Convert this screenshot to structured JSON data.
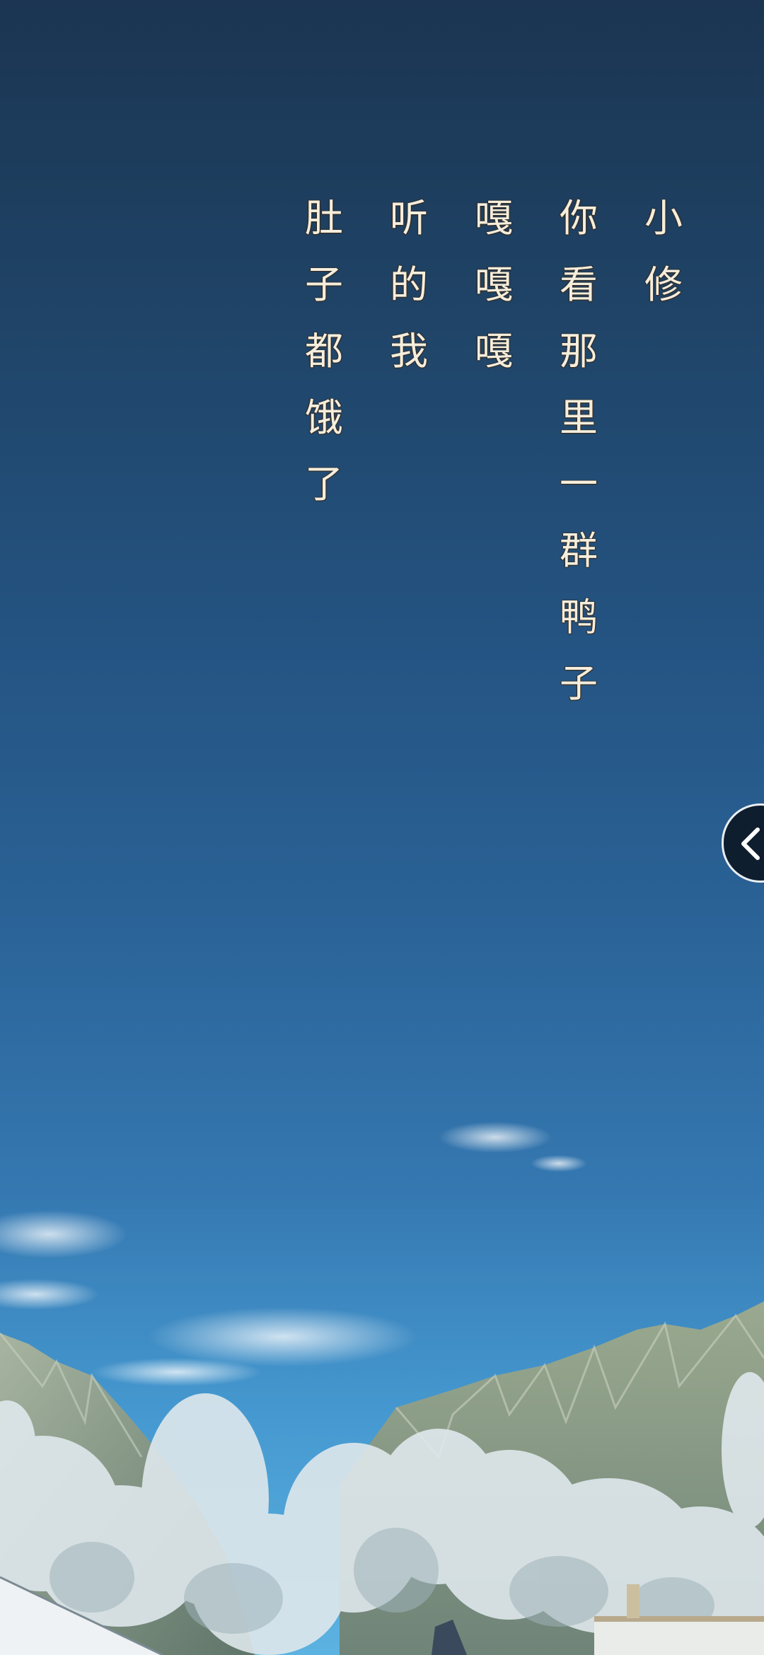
{
  "dialogue": {
    "columns": [
      {
        "chars": [
          "小",
          "修"
        ]
      },
      {
        "chars": [
          "你",
          "看",
          "那",
          "里",
          "一",
          "群",
          "鸭",
          "子"
        ]
      },
      {
        "chars": [
          "嘎",
          "嘎",
          "嘎"
        ]
      },
      {
        "chars": [
          "听",
          "的",
          "我"
        ]
      },
      {
        "chars": [
          "肚",
          "子",
          "都",
          "饿",
          "了"
        ]
      }
    ]
  },
  "side_tab": {
    "icon": "chevron-left-icon"
  },
  "colors": {
    "sky_top": "#1b3552",
    "sky_bottom": "#5cb2e0",
    "text": "#f4eede",
    "mountain": "#8a9c8a",
    "snow_tree": "#dbe6ea"
  }
}
